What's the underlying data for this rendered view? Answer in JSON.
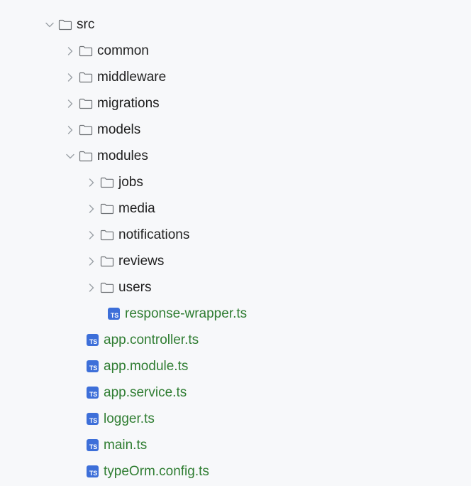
{
  "tree": {
    "root": {
      "label": "src",
      "expanded": true,
      "icon": "folder-icon",
      "chevron": "chevron-down-icon"
    },
    "folders": [
      {
        "label": "common",
        "expanded": false
      },
      {
        "label": "middleware",
        "expanded": false
      },
      {
        "label": "migrations",
        "expanded": false
      },
      {
        "label": "models",
        "expanded": false
      },
      {
        "label": "modules",
        "expanded": true
      }
    ],
    "module_folders": [
      {
        "label": "jobs",
        "expanded": false
      },
      {
        "label": "media",
        "expanded": false
      },
      {
        "label": "notifications",
        "expanded": false
      },
      {
        "label": "reviews",
        "expanded": false
      },
      {
        "label": "users",
        "expanded": false
      }
    ],
    "module_files": [
      {
        "label": "response-wrapper.ts",
        "icon": "typescript-file-icon",
        "icon_text": "TS"
      }
    ],
    "files": [
      {
        "label": "app.controller.ts",
        "icon": "typescript-file-icon",
        "icon_text": "TS"
      },
      {
        "label": "app.module.ts",
        "icon": "typescript-file-icon",
        "icon_text": "TS"
      },
      {
        "label": "app.service.ts",
        "icon": "typescript-file-icon",
        "icon_text": "TS"
      },
      {
        "label": "logger.ts",
        "icon": "typescript-file-icon",
        "icon_text": "TS"
      },
      {
        "label": "main.ts",
        "icon": "typescript-file-icon",
        "icon_text": "TS"
      },
      {
        "label": "typeOrm.config.ts",
        "icon": "typescript-file-icon",
        "icon_text": "TS"
      }
    ]
  },
  "colors": {
    "background": "#f7f8fa",
    "folder_text": "#1f1f1f",
    "file_text": "#2f7d32",
    "ts_icon_bg": "#3d6fd9",
    "chevron": "#9aa0a6",
    "folder_outline": "#6e7276"
  }
}
